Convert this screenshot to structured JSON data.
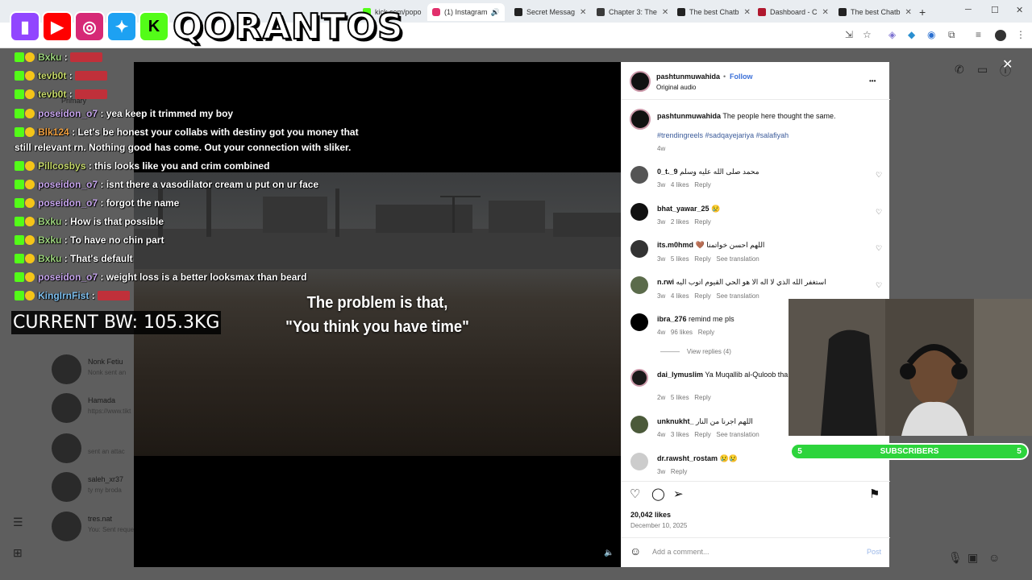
{
  "browser": {
    "tabs": [
      {
        "label": "kick.com/popo",
        "color": "#53fc18"
      },
      {
        "label": "(1) Instagram",
        "color": "#e1306c"
      },
      {
        "label": "Secret Messag",
        "color": "#222222"
      },
      {
        "label": "Chapter 3: The",
        "color": "#3a3a3a"
      },
      {
        "label": "The best Chatb",
        "color": "#222222"
      },
      {
        "label": "Dashboard - C",
        "color": "#b0182e"
      },
      {
        "label": "The best Chatb",
        "color": "#222222"
      }
    ],
    "new_tab": "+",
    "minimize": "─",
    "maximize": "☐",
    "close": "✕"
  },
  "overlay": {
    "brand": "QORANTOS",
    "current_bw": "CURRENT BW: 105.3KG",
    "subscribers_label": "SUBSCRIBERS",
    "subscribers_left": "5",
    "subscribers_right": "5"
  },
  "chat": [
    {
      "user": "Bxku",
      "color": "#9bd27c",
      "msg": ""
    },
    {
      "user": "tevb0t",
      "color": "#c6d96a",
      "msg": ""
    },
    {
      "user": "tevb0t",
      "color": "#c6d96a",
      "msg": ""
    },
    {
      "user": "poseidon_o7",
      "color": "#c8a6ef",
      "msg": "yea keep it trimmed my boy"
    },
    {
      "user": "Blk124",
      "color": "#f0a040",
      "msg": "Let's be honest your collabs with destiny got you money that"
    },
    {
      "user": "",
      "color": "#ffffff",
      "msg": "still relevant rn. Nothing good has come. Out your connection with sliker."
    },
    {
      "user": "Pillcosbys",
      "color": "#c6d96a",
      "msg": "this looks like you and crim combined"
    },
    {
      "user": "poseidon_o7",
      "color": "#c8a6ef",
      "msg": "isnt there a vasodilator cream u put on ur face"
    },
    {
      "user": "poseidon_o7",
      "color": "#c8a6ef",
      "msg": "forgot the name"
    },
    {
      "user": "Bxku",
      "color": "#9bd27c",
      "msg": "How is that possible"
    },
    {
      "user": "Bxku",
      "color": "#9bd27c",
      "msg": "To have no chin part"
    },
    {
      "user": "Bxku",
      "color": "#9bd27c",
      "msg": "That's default"
    },
    {
      "user": "poseidon_o7",
      "color": "#c8a6ef",
      "msg": "weight loss is a better looksmax than beard"
    },
    {
      "user": "KingIrnFist",
      "color": "#7ec0f0",
      "msg": ""
    }
  ],
  "backdrop": {
    "tab_primary": "Primary",
    "dms": [
      {
        "name": "Nonk Fetiu",
        "sub": "Nonk sent an"
      },
      {
        "name": "Hamada",
        "sub": "https://www.tikt"
      },
      {
        "name": "",
        "sub": "sent an attac"
      },
      {
        "name": "saleh_xr37",
        "sub": "ty my broda"
      },
      {
        "name": "tres.nat",
        "sub": "You: Sent reque"
      }
    ]
  },
  "video": {
    "caption_line1": "The problem is that,",
    "caption_line2": "\"You think you have time\""
  },
  "post": {
    "username": "pashtunmuwahida",
    "follow": "Follow",
    "audio": "Original audio",
    "more": "•••",
    "caption_user": "pashtunmuwahida",
    "caption_text": "The people here thought the same.",
    "hashtags": "#trendingreels #sadqayejariya #salafiyah",
    "caption_age": "4w",
    "likes": "20,042 likes",
    "date": "December 10, 2025",
    "comment_placeholder": "Add a comment...",
    "post_btn": "Post"
  },
  "comments": [
    {
      "user": "0_t._9",
      "text": "محمد صلى الله عليه وسلم",
      "age": "3w",
      "likes": "4 likes",
      "reply": "Reply",
      "translate": ""
    },
    {
      "user": "bhat_yawar_25",
      "text": "😢",
      "age": "3w",
      "likes": "2 likes",
      "reply": "Reply",
      "translate": ""
    },
    {
      "user": "its.m0hmd",
      "text": "🤎 اللهم احسن خواتمنا",
      "age": "3w",
      "likes": "5 likes",
      "reply": "Reply",
      "translate": "See translation"
    },
    {
      "user": "n.rwi",
      "text": "استغفر الله الذي لا اله الا هو الحي القيوم اتوب اليه",
      "age": "3w",
      "likes": "4 likes",
      "reply": "Reply",
      "translate": "See translation"
    },
    {
      "user": "ibra_276",
      "text": "remind me pls",
      "age": "4w",
      "likes": "96 likes",
      "reply": "Reply",
      "translate": ""
    },
    {
      "user": "dai_lymuslim",
      "text": "Ya Muqallib al-Quloob tha",
      "age": "2w",
      "likes": "5 likes",
      "reply": "Reply",
      "translate": ""
    },
    {
      "user": "unknukht_",
      "text": "اللهم اجرنا من النار",
      "age": "4w",
      "likes": "3 likes",
      "reply": "Reply",
      "translate": "See translation"
    },
    {
      "user": "dr.rawsht_rostam",
      "text": "😢😢",
      "age": "3w",
      "likes": "",
      "reply": "Reply",
      "translate": ""
    }
  ],
  "view_replies": "View replies (4)"
}
